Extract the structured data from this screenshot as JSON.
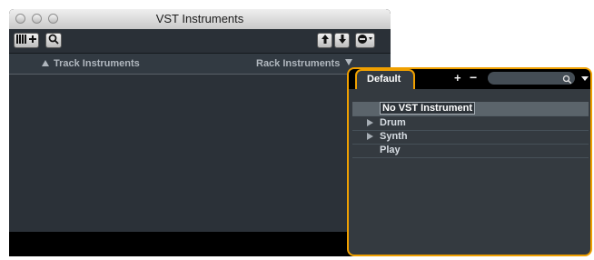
{
  "window": {
    "title": "VST Instruments"
  },
  "toolbar": {
    "left_buttons": [
      {
        "icon": "keyboard-add-icon"
      },
      {
        "icon": "search-icon"
      }
    ],
    "right_buttons": [
      {
        "icon": "arrow-up-icon"
      },
      {
        "icon": "arrow-down-icon"
      },
      {
        "icon": "preset-menu-icon"
      }
    ]
  },
  "columns": {
    "track_instruments": "Track Instruments",
    "rack_instruments": "Rack Instruments"
  },
  "popup": {
    "tab_label": "Default",
    "plus": "+",
    "minus": "−",
    "search_placeholder": "",
    "items": [
      {
        "label": "No VST Instrument",
        "expandable": false,
        "selected": true
      },
      {
        "label": "Drum",
        "expandable": true,
        "selected": false
      },
      {
        "label": "Synth",
        "expandable": true,
        "selected": false
      },
      {
        "label": "Play",
        "expandable": false,
        "selected": false
      }
    ]
  },
  "colors": {
    "accent": "#f0a000",
    "panel": "#343a40",
    "list_bg": "#2b3138",
    "header_bg": "#323a42"
  }
}
